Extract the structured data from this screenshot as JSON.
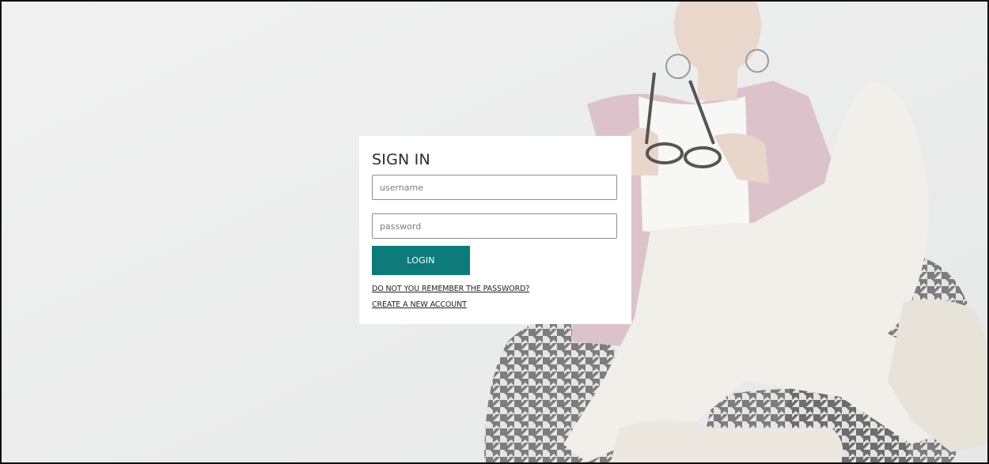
{
  "login": {
    "title": "SIGN IN",
    "username_placeholder": "username",
    "password_placeholder": "password",
    "login_label": "LOGIN",
    "forgot_link": "DO NOT YOU REMEMBER THE PASSWORD?",
    "create_link": "CREATE A NEW ACCOUNT"
  },
  "colors": {
    "accent": "#0c7b79",
    "background": "#eceded",
    "card": "#ffffff"
  }
}
